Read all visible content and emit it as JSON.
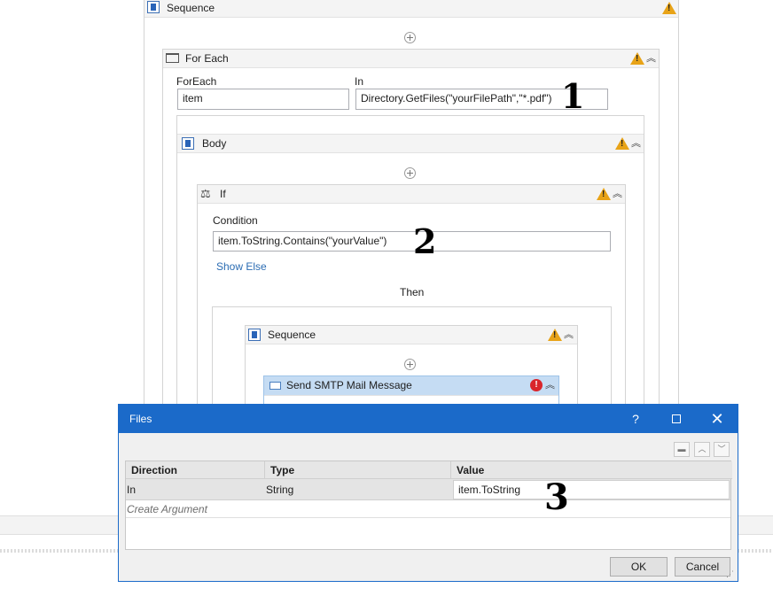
{
  "outer_sequence": {
    "title": "Sequence"
  },
  "for_each": {
    "title": "For Each",
    "foreach_label": "ForEach",
    "foreach_value": "item",
    "in_label": "In",
    "in_value": "Directory.GetFiles(\"yourFilePath\",\"*.pdf\")"
  },
  "body": {
    "title": "Body"
  },
  "if_activity": {
    "title": "If",
    "condition_label": "Condition",
    "condition_value": "item.ToString.Contains(\"yourValue\")",
    "show_else": "Show Else",
    "then_label": "Then"
  },
  "inner_sequence": {
    "title": "Sequence"
  },
  "smtp": {
    "title": "Send SMTP Mail Message"
  },
  "annotations": {
    "one": "1",
    "two": "2",
    "three": "3"
  },
  "dialog": {
    "title": "Files",
    "help": "?",
    "columns": [
      "Direction",
      "Type",
      "Value"
    ],
    "rows": [
      {
        "direction": "In",
        "type": "String",
        "value": "item.ToString"
      }
    ],
    "create_argument": "Create Argument",
    "ok": "OK",
    "cancel": "Cancel"
  },
  "colors": {
    "accent": "#1b6ac9",
    "warning": "#e8a317",
    "error": "#d9252b",
    "smtp_header": "#c5dcf3"
  }
}
